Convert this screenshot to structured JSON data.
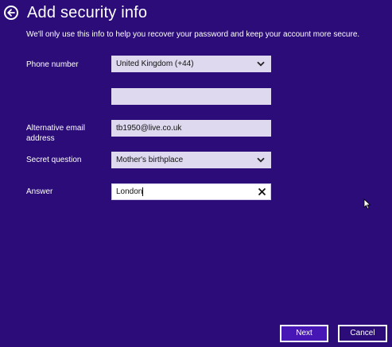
{
  "header": {
    "title": "Add security info",
    "back_icon": "back-arrow-icon"
  },
  "intro_text": "We'll only use this info to help you recover your password and keep your account more secure.",
  "form": {
    "phone": {
      "label": "Phone number",
      "country_value": "United Kingdom (+44)",
      "number_value": ""
    },
    "alt_email": {
      "label_line1": "Alternative email",
      "label_line2": "address",
      "value": "tb1950@live.co.uk"
    },
    "secret_question": {
      "label": "Secret question",
      "value": "Mother's birthplace"
    },
    "answer": {
      "label": "Answer",
      "value": "London"
    }
  },
  "buttons": {
    "next_label": "Next",
    "cancel_label": "Cancel"
  },
  "colors": {
    "background": "#2b0c79",
    "field_fill": "#ded9ef",
    "next_fill": "#4617b4",
    "text": "#ffffff"
  }
}
